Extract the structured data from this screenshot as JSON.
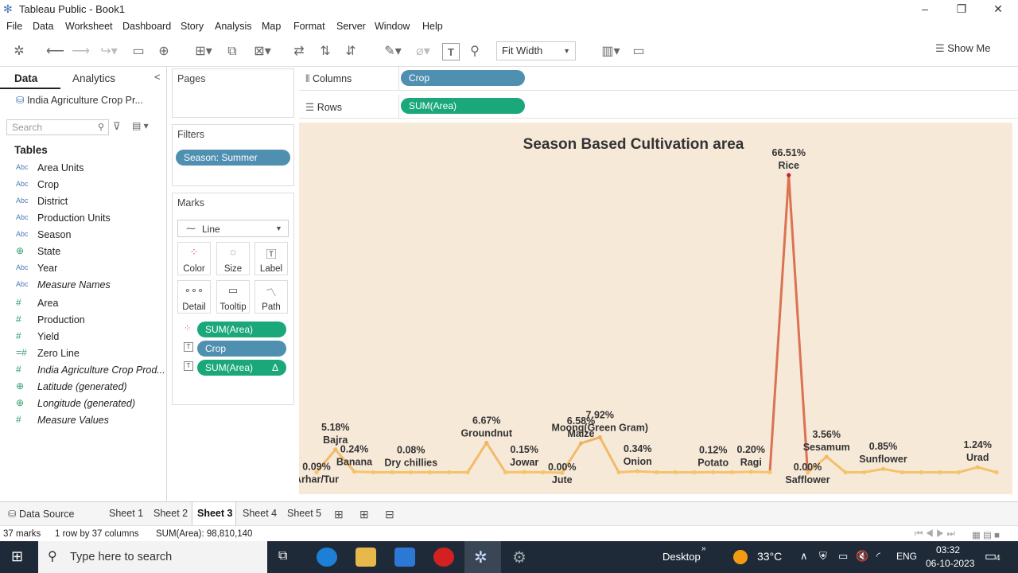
{
  "window": {
    "title": "Tableau Public - Book1",
    "min": "–",
    "max": "❐",
    "close": "✕"
  },
  "menu": [
    "File",
    "Data",
    "Worksheet",
    "Dashboard",
    "Story",
    "Analysis",
    "Map",
    "Format",
    "Server",
    "Window",
    "Help"
  ],
  "toolbar": {
    "fit": "Fit Width",
    "show_me": "Show Me"
  },
  "data_pane": {
    "tab_data": "Data",
    "tab_analytics": "Analytics",
    "datasource": "India Agriculture Crop Pr...",
    "search_placeholder": "Search",
    "tables_heading": "Tables",
    "fields": [
      {
        "type": "Abc",
        "name": "Area Units"
      },
      {
        "type": "Abc",
        "name": "Crop"
      },
      {
        "type": "Abc",
        "name": "District"
      },
      {
        "type": "Abc",
        "name": "Production Units"
      },
      {
        "type": "Abc",
        "name": "Season"
      },
      {
        "type": "globe",
        "name": "State"
      },
      {
        "type": "Abc",
        "name": "Year"
      },
      {
        "type": "Abc",
        "name": "Measure Names"
      },
      {
        "type": "#",
        "name": "Area"
      },
      {
        "type": "#",
        "name": "Production"
      },
      {
        "type": "#",
        "name": "Yield"
      },
      {
        "type": "#",
        "name": "Zero Line"
      },
      {
        "type": "#",
        "name": "India Agriculture Crop Prod..."
      },
      {
        "type": "globe",
        "name": "Latitude (generated)"
      },
      {
        "type": "globe",
        "name": "Longitude (generated)"
      },
      {
        "type": "#",
        "name": "Measure Values"
      }
    ]
  },
  "cards": {
    "pages": "Pages",
    "filters": "Filters",
    "filter_pill": "Season: Summer",
    "marks": "Marks",
    "mark_type": "Line",
    "buttons": [
      "Color",
      "Size",
      "Label",
      "Detail",
      "Tooltip",
      "Path"
    ],
    "mark_pills": [
      "SUM(Area)",
      "Crop",
      "SUM(Area)"
    ],
    "delta": "Δ"
  },
  "shelves": {
    "columns_label": "Columns",
    "columns_pill": "Crop",
    "rows_label": "Rows",
    "rows_pill": "SUM(Area)"
  },
  "chart_data": {
    "type": "line",
    "title": "Season Based Cultivation area",
    "x": [
      "Arhar/Tur",
      "Bajra",
      "Banana",
      "",
      "",
      "Dry chillies",
      "",
      "",
      "",
      "Groundnut",
      "",
      "Jowar",
      "",
      "Jute",
      "Maize",
      "Moong(Green Gram)",
      "",
      "Onion",
      "",
      "",
      "",
      "Potato",
      "",
      "Ragi",
      "",
      "Rice",
      "Safflower",
      "Sesamum",
      "",
      "",
      "Sunflower",
      "",
      "",
      "",
      "",
      "Urad",
      ""
    ],
    "values": [
      0.09,
      5.18,
      0.24,
      0.1,
      0.1,
      0.08,
      0.1,
      0.1,
      0.1,
      6.67,
      0.1,
      0.15,
      0.1,
      0.0,
      6.58,
      7.92,
      0.1,
      0.34,
      0.1,
      0.1,
      0.1,
      0.12,
      0.1,
      0.2,
      0.1,
      66.51,
      0.0,
      3.56,
      0.1,
      0.1,
      0.85,
      0.1,
      0.1,
      0.1,
      0.1,
      1.24,
      0.1
    ],
    "labels": [
      {
        "i": 0,
        "pct": "0.09%",
        "crop": "Arhar/Tur",
        "pos": "below"
      },
      {
        "i": 1,
        "pct": "5.18%",
        "crop": "Bajra",
        "pos": "above"
      },
      {
        "i": 2,
        "pct": "0.24%",
        "crop": "Banana",
        "pos": "above"
      },
      {
        "i": 5,
        "pct": "0.08%",
        "crop": "Dry chillies",
        "pos": "above"
      },
      {
        "i": 9,
        "pct": "6.67%",
        "crop": "Groundnut",
        "pos": "above"
      },
      {
        "i": 11,
        "pct": "0.15%",
        "crop": "Jowar",
        "pos": "above"
      },
      {
        "i": 13,
        "pct": "0.00%",
        "crop": "Jute",
        "pos": "below"
      },
      {
        "i": 14,
        "pct": "6.58%",
        "crop": "Maize",
        "pos": "above"
      },
      {
        "i": 15,
        "pct": "7.92%",
        "crop": "Moong(Green Gram)",
        "pos": "above"
      },
      {
        "i": 17,
        "pct": "0.34%",
        "crop": "Onion",
        "pos": "above"
      },
      {
        "i": 21,
        "pct": "0.12%",
        "crop": "Potato",
        "pos": "above"
      },
      {
        "i": 23,
        "pct": "0.20%",
        "crop": "Ragi",
        "pos": "above"
      },
      {
        "i": 25,
        "pct": "66.51%",
        "crop": "Rice",
        "pos": "above"
      },
      {
        "i": 26,
        "pct": "0.00%",
        "crop": "Safflower",
        "pos": "below"
      },
      {
        "i": 27,
        "pct": "3.56%",
        "crop": "Sesamum",
        "pos": "above"
      },
      {
        "i": 30,
        "pct": "0.85%",
        "crop": "Sunflower",
        "pos": "above"
      },
      {
        "i": 35,
        "pct": "1.24%",
        "crop": "Urad",
        "pos": "above"
      }
    ],
    "color_low": "#f5c36a",
    "color_high": "#c0233a",
    "background": "#f6e9d8"
  },
  "sheets": [
    "Data Source",
    "Sheet 1",
    "Sheet 2",
    "Sheet 3",
    "Sheet 4",
    "Sheet 5"
  ],
  "active_sheet": "Sheet 3",
  "status": {
    "marks": "37 marks",
    "shape": "1 row by 37 columns",
    "sum": "SUM(Area): 98,810,140"
  },
  "taskbar": {
    "search": "Type here to search",
    "desktop": "Desktop",
    "temp": "33°C",
    "lang": "ENG",
    "time": "03:32",
    "date": "06-10-2023",
    "notif": "4"
  }
}
